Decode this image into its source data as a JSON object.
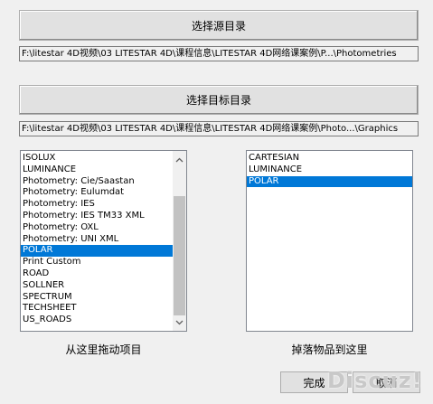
{
  "buttons": {
    "select_source": "选择源目录",
    "select_target": "选择目标目录",
    "done": "完成",
    "cancel": "取消"
  },
  "paths": {
    "source": "F:\\litestar 4D视频\\03 LITESTAR 4D\\课程信息\\LITESTAR 4D网络课案例\\P...\\Photometries",
    "target": "F:\\litestar 4D视频\\03 LITESTAR 4D\\课程信息\\LITESTAR 4D网络课案例\\Photo...\\Graphics"
  },
  "source_list": {
    "items": [
      "ISOLUX",
      "LUMINANCE",
      "Photometry: Cie/Saastan",
      "Photometry: Eulumdat",
      "Photometry: IES",
      "Photometry: IES TM33 XML",
      "Photometry: OXL",
      "Photometry: UNI XML",
      "POLAR",
      "Print Custom",
      "ROAD",
      "SOLLNER",
      "SPECTRUM",
      "TECHSHEET",
      "US_ROADS"
    ],
    "selected": "POLAR",
    "caption": "从这里拖动项目"
  },
  "target_list": {
    "items": [
      "CARTESIAN",
      "LUMINANCE",
      "POLAR"
    ],
    "selected": "POLAR",
    "caption": "掉落物品到这里"
  },
  "watermark": "Discuz!"
}
